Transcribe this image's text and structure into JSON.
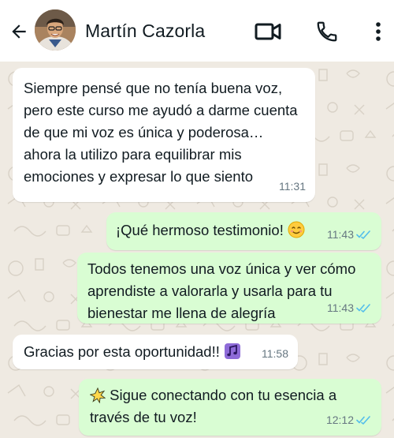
{
  "contact": {
    "name": "Martín Cazorla"
  },
  "icons": {
    "back": "arrow-left-icon",
    "video": "video-camera-icon",
    "call": "phone-icon",
    "menu": "more-vertical-icon",
    "read_receipt": "double-check-icon"
  },
  "colors": {
    "chat_background": "#efeae2",
    "incoming_bubble": "#ffffff",
    "outgoing_bubble": "#d9fdd3",
    "read_tick": "#53bdeb"
  },
  "messages": [
    {
      "direction": "incoming",
      "text": "Siempre pensé que no tenía buena voz, pero este curso me ayudó a darme cuenta de que mi voz es única y poderosa… ahora la utilizo para equilibrar mis emociones y expresar lo que siento",
      "time": "11:31"
    },
    {
      "direction": "outgoing",
      "text": "¡Qué hermoso testimonio!",
      "emoji": "smiling-face-icon",
      "time": "11:43",
      "read": true
    },
    {
      "direction": "outgoing",
      "text": "Todos tenemos una voz única y ver cómo aprendiste a valorarla y usarla para tu bienestar me llena de alegría",
      "time": "11:43",
      "read": true
    },
    {
      "direction": "incoming",
      "text": "Gracias por esta oportunidad!!",
      "emoji": "musical-notes-icon",
      "time": "11:58"
    },
    {
      "direction": "outgoing",
      "emoji": "sparkle-icon",
      "text": "Sigue conectando con tu esencia a través de tu voz!",
      "time": "12:12",
      "read": true
    }
  ]
}
